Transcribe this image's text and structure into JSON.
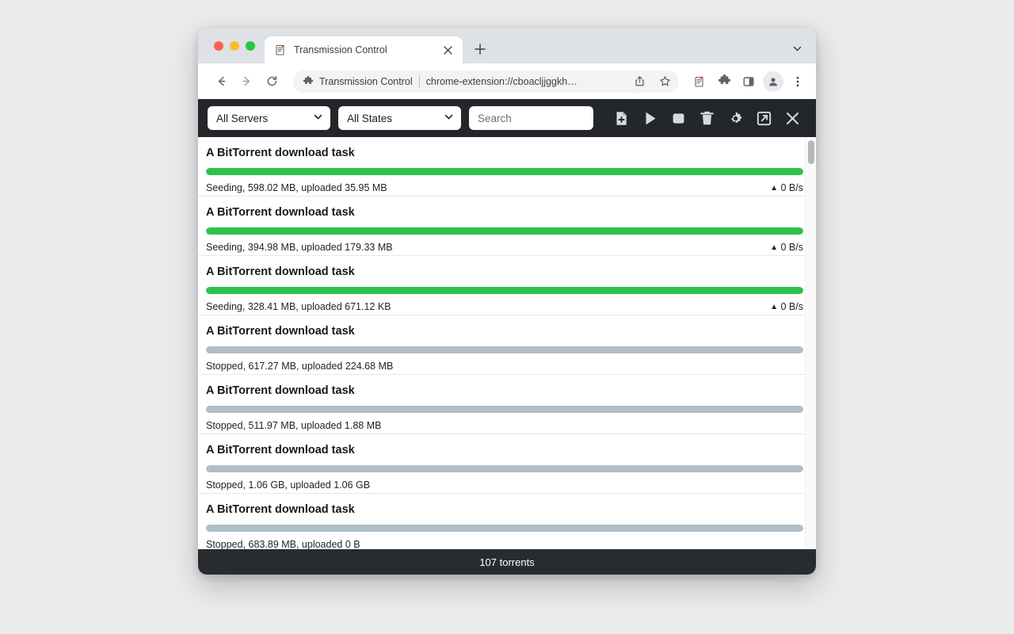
{
  "browser": {
    "tab": {
      "title": "Transmission Control",
      "favicon_icon": "transmission-favicon",
      "close_icon": "close-icon"
    },
    "new_tab_icon": "plus-icon",
    "tab_search_icon": "chevron-down-icon",
    "nav": {
      "back_icon": "arrow-left-icon",
      "forward_icon": "arrow-right-icon",
      "reload_icon": "reload-icon"
    },
    "omnibox": {
      "extension_icon": "puzzle-piece-icon",
      "extension_name": "Transmission Control",
      "url": "chrome-extension://cboacljjggkh…",
      "share_icon": "share-icon",
      "bookmark_icon": "star-icon"
    },
    "toolbar_icons": [
      {
        "name": "extension-favicon-icon"
      },
      {
        "name": "extensions-puzzle-icon"
      },
      {
        "name": "side-panel-icon"
      },
      {
        "name": "profile-avatar-icon"
      },
      {
        "name": "three-dot-menu-icon"
      }
    ]
  },
  "app": {
    "filters": {
      "server": {
        "label": "All Servers",
        "chevron_icon": "chevron-down-icon"
      },
      "state": {
        "label": "All States",
        "chevron_icon": "chevron-down-icon"
      }
    },
    "search": {
      "value": "",
      "placeholder": "Search"
    },
    "actions": [
      {
        "name": "add-torrent-button",
        "icon": "file-plus-icon"
      },
      {
        "name": "start-button",
        "icon": "play-icon"
      },
      {
        "name": "stop-button",
        "icon": "stop-icon"
      },
      {
        "name": "delete-button",
        "icon": "trash-icon"
      },
      {
        "name": "settings-button",
        "icon": "gear-icon"
      },
      {
        "name": "open-external-button",
        "icon": "external-link-icon"
      },
      {
        "name": "close-button",
        "icon": "close-icon"
      }
    ],
    "colors": {
      "seeding": "#2ec14e",
      "stopped": "#b0bec5",
      "toolbar_bg": "#23262b",
      "status_bg": "#282c31"
    },
    "torrents": [
      {
        "title": "A BitTorrent download task",
        "state": "Seeding",
        "meta": "Seeding, 598.02 MB, uploaded 35.95 MB",
        "progress": 100,
        "speed": "0 B/s",
        "speed_direction": "up",
        "show_speed": true
      },
      {
        "title": "A BitTorrent download task",
        "state": "Seeding",
        "meta": "Seeding, 394.98 MB, uploaded 179.33 MB",
        "progress": 100,
        "speed": "0 B/s",
        "speed_direction": "up",
        "show_speed": true
      },
      {
        "title": "A BitTorrent download task",
        "state": "Seeding",
        "meta": "Seeding, 328.41 MB, uploaded 671.12 KB",
        "progress": 100,
        "speed": "0 B/s",
        "speed_direction": "up",
        "show_speed": true
      },
      {
        "title": "A BitTorrent download task",
        "state": "Stopped",
        "meta": "Stopped, 617.27 MB, uploaded 224.68 MB",
        "progress": 100,
        "speed": "",
        "speed_direction": "",
        "show_speed": false
      },
      {
        "title": "A BitTorrent download task",
        "state": "Stopped",
        "meta": "Stopped, 511.97 MB, uploaded 1.88 MB",
        "progress": 100,
        "speed": "",
        "speed_direction": "",
        "show_speed": false
      },
      {
        "title": "A BitTorrent download task",
        "state": "Stopped",
        "meta": "Stopped, 1.06 GB, uploaded 1.06 GB",
        "progress": 100,
        "speed": "",
        "speed_direction": "",
        "show_speed": false
      },
      {
        "title": "A BitTorrent download task",
        "state": "Stopped",
        "meta": "Stopped, 683.89 MB, uploaded 0 B",
        "progress": 100,
        "speed": "",
        "speed_direction": "",
        "show_speed": false
      }
    ],
    "status_bar": {
      "text": "107 torrents"
    }
  }
}
